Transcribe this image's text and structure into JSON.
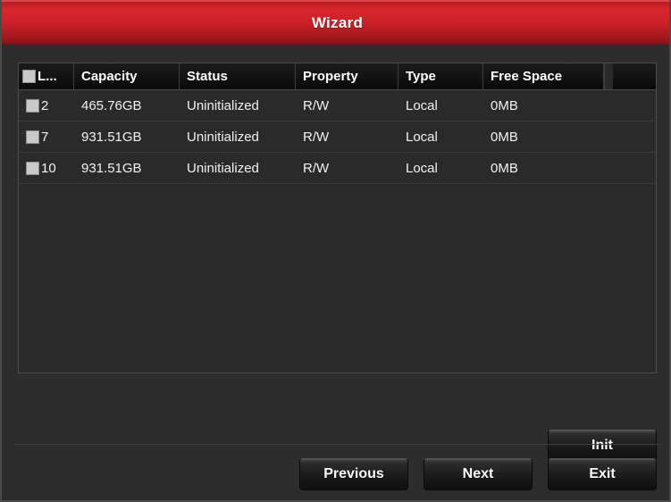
{
  "window": {
    "title": "Wizard",
    "accent_color": "#c72127",
    "background_color": "#2c2c2c"
  },
  "hdd_table": {
    "columns": [
      {
        "key": "label",
        "header": "L...",
        "has_checkbox": true
      },
      {
        "key": "capacity",
        "header": "Capacity"
      },
      {
        "key": "status",
        "header": "Status"
      },
      {
        "key": "property",
        "header": "Property"
      },
      {
        "key": "type",
        "header": "Type"
      },
      {
        "key": "free_space",
        "header": "Free Space"
      }
    ],
    "rows": [
      {
        "label": "2",
        "capacity": "465.76GB",
        "status": "Uninitialized",
        "property": "R/W",
        "type": "Local",
        "free_space": "0MB",
        "checked": false
      },
      {
        "label": "7",
        "capacity": "931.51GB",
        "status": "Uninitialized",
        "property": "R/W",
        "type": "Local",
        "free_space": "0MB",
        "checked": false
      },
      {
        "label": "10",
        "capacity": "931.51GB",
        "status": "Uninitialized",
        "property": "R/W",
        "type": "Local",
        "free_space": "0MB",
        "checked": false
      }
    ]
  },
  "actions": {
    "init_label": "Init",
    "previous_label": "Previous",
    "next_label": "Next",
    "exit_label": "Exit"
  }
}
